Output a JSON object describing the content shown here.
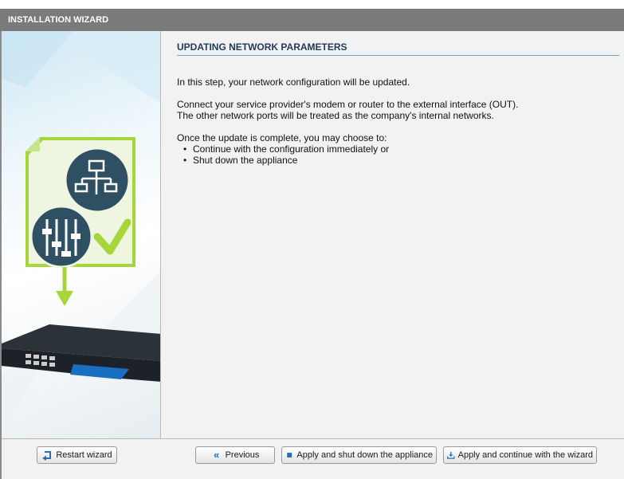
{
  "window": {
    "title": "INSTALLATION WIZARD"
  },
  "page": {
    "heading": "UPDATING NETWORK PARAMETERS",
    "intro": "In this step, your network configuration will be updated.",
    "connect_line1": "Connect your service provider's modem or router to the external interface (OUT).",
    "connect_line2": "The other network ports will be treated as the company's internal networks.",
    "choice_intro": "Once the update is complete, you may choose to:",
    "options": [
      "Continue with the configuration immediately or",
      "Shut down the appliance"
    ]
  },
  "footer": {
    "restart_label": "Restart wizard",
    "previous_label": "Previous",
    "shutdown_label": "Apply and shut down the appliance",
    "continue_label": "Apply and continue with the wizard"
  },
  "icons": {
    "restart": "restart-icon",
    "previous": "double-chevron-left-icon",
    "shutdown": "stop-square-icon",
    "continue": "download-apply-icon"
  },
  "colors": {
    "titlebar": "#7a7a7a",
    "heading_text": "#243a55",
    "heading_rule": "#6aa6d6",
    "accent_green": "#a6d63a",
    "icon_circle": "#2f4f63",
    "button_icon_blue": "#2a6fb5"
  }
}
